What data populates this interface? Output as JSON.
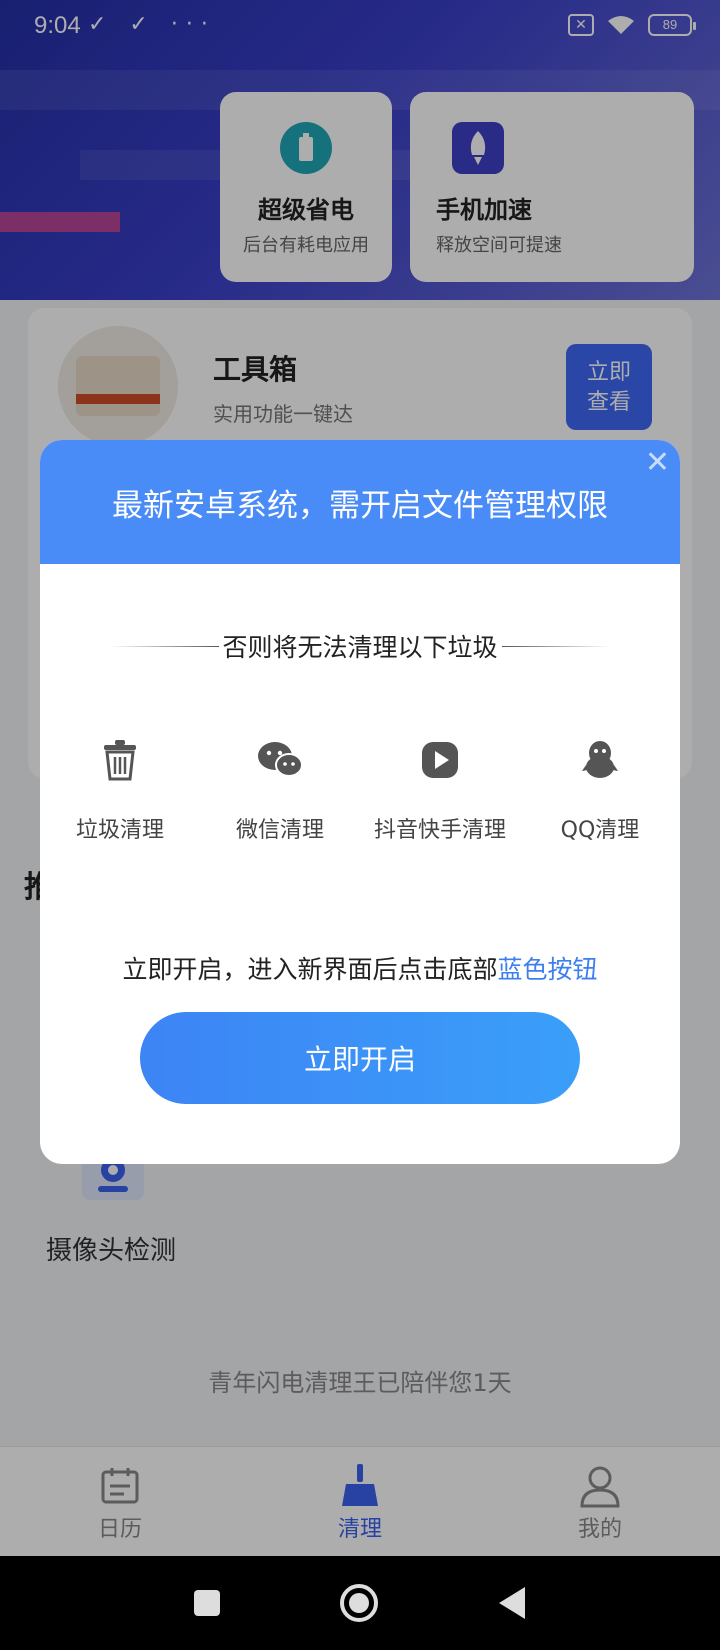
{
  "status_bar": {
    "time": "9:04",
    "left_icons": "✓ ✓ ···",
    "sim": "✕",
    "battery": "89"
  },
  "quick_cards": [
    {
      "title": "超级省电",
      "subtitle": "后台有耗电应用",
      "icon": "battery-icon",
      "color": "#1fa9b8"
    },
    {
      "title": "手机加速",
      "subtitle": "释放空间可提速",
      "icon": "rocket-icon",
      "color": "#3e3ec8"
    }
  ],
  "toolbox": {
    "title": "工具箱",
    "subtitle": "实用功能一键达",
    "button_line1": "立即",
    "button_line2": "查看"
  },
  "section_partial": "推",
  "camera": {
    "label": "摄像头检测"
  },
  "accompany_text": "青年闪电清理王已陪伴您1天",
  "tabs": [
    {
      "label": "日历",
      "icon": "calendar-icon"
    },
    {
      "label": "清理",
      "icon": "broom-icon"
    },
    {
      "label": "我的",
      "icon": "profile-icon"
    }
  ],
  "dialog": {
    "title": "最新安卓系统，需开启文件管理权限",
    "close": "✕",
    "subtitle": "否则将无法清理以下垃圾",
    "items": [
      {
        "label": "垃圾清理",
        "icon": "trash-icon"
      },
      {
        "label": "微信清理",
        "icon": "wechat-icon"
      },
      {
        "label": "抖音快手清理",
        "icon": "video-play-icon"
      },
      {
        "label": "QQ清理",
        "icon": "qq-penguin-icon"
      }
    ],
    "instruction_prefix": "立即开启，进入新界面后点击底部",
    "instruction_highlight": "蓝色按钮",
    "button_label": "立即开启"
  },
  "colors": {
    "accent_blue": "#4a8cf7",
    "tab_active": "#3a62ef"
  }
}
